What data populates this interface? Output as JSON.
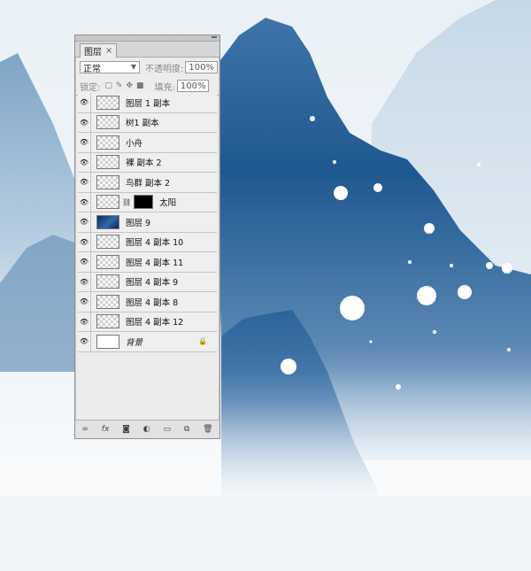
{
  "panel": {
    "tab_label": "图层",
    "close_glyph": "×",
    "blend_mode": "正常",
    "opacity_label": "不透明度:",
    "opacity_value": "100%",
    "lock_label": "锁定:",
    "fill_label": "填充:",
    "fill_value": "100%"
  },
  "layers": [
    {
      "name": "图层 1 副本",
      "thumb": "transparent",
      "visible": true
    },
    {
      "name": "树1 副本",
      "thumb": "transparent",
      "visible": true
    },
    {
      "name": "小舟",
      "thumb": "transparent",
      "visible": true
    },
    {
      "name": "裸 副本 2",
      "thumb": "transparent",
      "visible": true
    },
    {
      "name": "鸟群 副本 2",
      "thumb": "transparent",
      "visible": true
    },
    {
      "name": "太阳",
      "thumb": "transparent",
      "visible": true,
      "has_mask": true
    },
    {
      "name": "图层 9",
      "thumb": "blue",
      "visible": true
    },
    {
      "name": "图层 4 副本 10",
      "thumb": "transparent",
      "visible": true
    },
    {
      "name": "图层 4 副本 11",
      "thumb": "transparent",
      "visible": true
    },
    {
      "name": "图层 4 副本 9",
      "thumb": "transparent",
      "visible": true
    },
    {
      "name": "图层 4 副本 8",
      "thumb": "transparent",
      "visible": true
    },
    {
      "name": "图层 4 副本 12",
      "thumb": "transparent",
      "visible": true
    },
    {
      "name": "背景",
      "thumb": "white",
      "visible": true,
      "italic": true,
      "locked": true
    }
  ],
  "bottom_icons": [
    "link-icon",
    "fx-icon",
    "mask-icon",
    "adjustment-icon",
    "folder-icon",
    "new-layer-icon",
    "trash-icon"
  ],
  "colors": {
    "mountain_dark": "#184f86",
    "mountain_mid": "#4f7fae",
    "mountain_light": "#9dbbd6",
    "sky": "#eef3f7"
  }
}
